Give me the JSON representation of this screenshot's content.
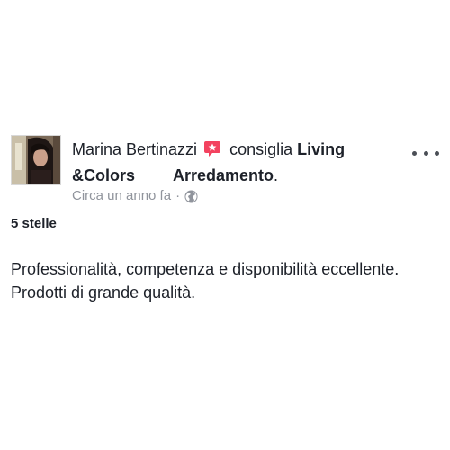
{
  "post": {
    "author": "Marina Bertinazzi",
    "action": "consiglia",
    "page_name_part1": "Living",
    "page_name_part2": "&Colors",
    "page_name_part3": "Arredamento",
    "page_name_end": ".",
    "timestamp": "Circa un anno fa",
    "meta_separator": "·",
    "privacy_icon": "globe-icon",
    "recommend_icon": "recommend-badge-icon",
    "recommend_color": "#f3425f",
    "more_icon": "more-options-icon",
    "rating": "5 stelle",
    "review_line1": "Professionalità, competenza e disponibilità eccellente.",
    "review_line2": "Prodotti di grande qualità."
  }
}
